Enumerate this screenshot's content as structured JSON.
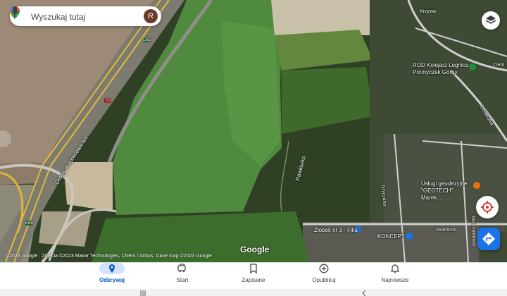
{
  "search": {
    "placeholder": "Wyszukaj tutaj",
    "avatar_initial": "R"
  },
  "map_labels": {
    "road_s3": "Droga ekspresowa S3",
    "road_e65_a": "E65",
    "road_s3_b": "S3",
    "road_e65_b": "E65",
    "krzywa_street": "Krzywa",
    "pawlowka": "Pawłówka",
    "dzialkowa": "Działkowa",
    "cienista": "Ciem",
    "rod": "ROD Kolejarz Legnica Promyczek Górny",
    "geotech": "Usługi geodezyjne \"GEOTECH\" Marek...",
    "zlobek": "Żłobek nr 3 - Filia",
    "koncept": "KONCEPT",
    "rolnicza": "Rolnicza",
    "gryczana": "Gryczana",
    "modrzewiowa": "Modrzewiowa"
  },
  "google_logo": "Google",
  "attribution": "©2023 Google · Zdjęcia ©2023 Maxar Technologies, CNES / Airbus, Dane map ©2023 Google",
  "nav": {
    "items": [
      {
        "label": "Odkrywaj",
        "icon": "location-pin-icon",
        "active": true
      },
      {
        "label": "Start",
        "icon": "car-icon",
        "active": false
      },
      {
        "label": "Zapisane",
        "icon": "bookmark-icon",
        "active": false
      },
      {
        "label": "Opublikuj",
        "icon": "add-circle-icon",
        "active": false
      },
      {
        "label": "Najnowsze",
        "icon": "bell-icon",
        "active": false
      }
    ]
  },
  "colors": {
    "accent": "#1a73e8",
    "active_nav_bg": "#d3e3fd",
    "active_nav_text": "#0b57d0"
  }
}
